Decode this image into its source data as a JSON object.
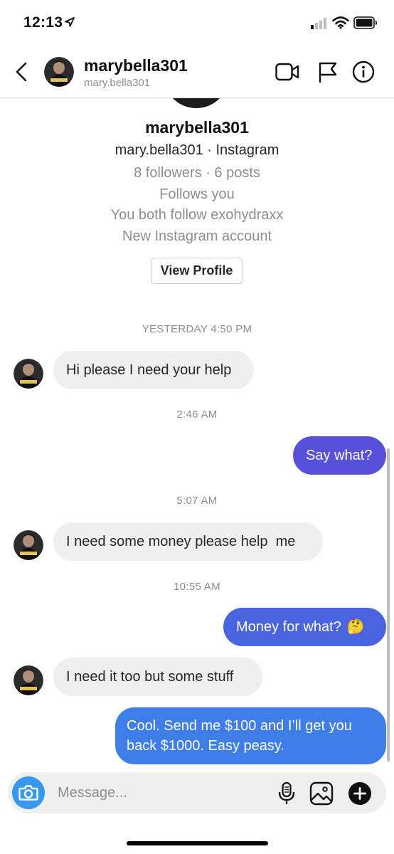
{
  "status_bar": {
    "time": "12:13",
    "icons": [
      "location-arrow-icon",
      "cellular-signal-icon",
      "wifi-icon",
      "battery-icon"
    ]
  },
  "header": {
    "username": "marybella301",
    "subtitle": "mary.bella301",
    "icons": [
      "back-icon",
      "video-call-icon",
      "flag-icon",
      "info-icon"
    ]
  },
  "profile": {
    "name": "marybella301",
    "handle_line": "mary.bella301 · Instagram",
    "stats": "8 followers · 6 posts",
    "follows_you": "Follows you",
    "mutual": "You both follow exohydraxx",
    "account_note": "New Instagram account",
    "view_profile_label": "View Profile"
  },
  "messages": [
    {
      "timestamp": "YESTERDAY 4:50 PM"
    },
    {
      "sender": "them",
      "text": "Hi please I need your help"
    },
    {
      "timestamp": "2:46 AM"
    },
    {
      "sender": "me",
      "text": "Say what?"
    },
    {
      "timestamp": "5:07 AM"
    },
    {
      "sender": "them",
      "text": "I need some money please help  me"
    },
    {
      "timestamp": "10:55 AM"
    },
    {
      "sender": "me",
      "text": "Money for what?",
      "emoji": "🤔"
    },
    {
      "sender": "them",
      "text": "I need it too but some stuff"
    },
    {
      "sender": "me",
      "text": "Cool. Send me $100 and I’ll get you back $1000. Easy peasy."
    }
  ],
  "composer": {
    "placeholder": "Message...",
    "icons": [
      "camera-icon",
      "microphone-icon",
      "gallery-icon",
      "plus-icon"
    ]
  },
  "colors": {
    "bubble_in": "#efefef",
    "bubble_out_purple": "#5851db",
    "bubble_out_blue_1": "#4a64e0",
    "bubble_out_blue_2": "#3f7ee8",
    "camera_button": "#3897f0",
    "secondary_text": "#8e8e8e"
  }
}
